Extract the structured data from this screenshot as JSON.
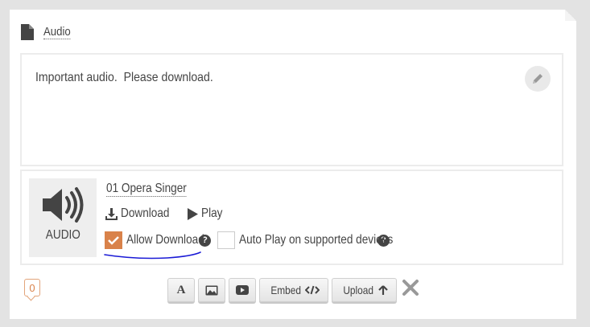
{
  "header": {
    "title": "Audio",
    "icon": "document-icon"
  },
  "description": {
    "text": "Important audio.  Please download."
  },
  "file": {
    "thumb_label": "AUDIO",
    "name": "01 Opera Singer",
    "download_label": "Download",
    "play_label": "Play"
  },
  "options": {
    "allow_download": {
      "label": "Allow Download",
      "checked": true
    },
    "autoplay": {
      "label": "Auto Play on supported devices",
      "checked": false
    }
  },
  "footer": {
    "counter": "0",
    "embed_label": "Embed",
    "upload_label": "Upload",
    "text_btn_glyph": "A"
  },
  "colors": {
    "accent": "#d9824a",
    "annotation": "#1a1ad6"
  }
}
